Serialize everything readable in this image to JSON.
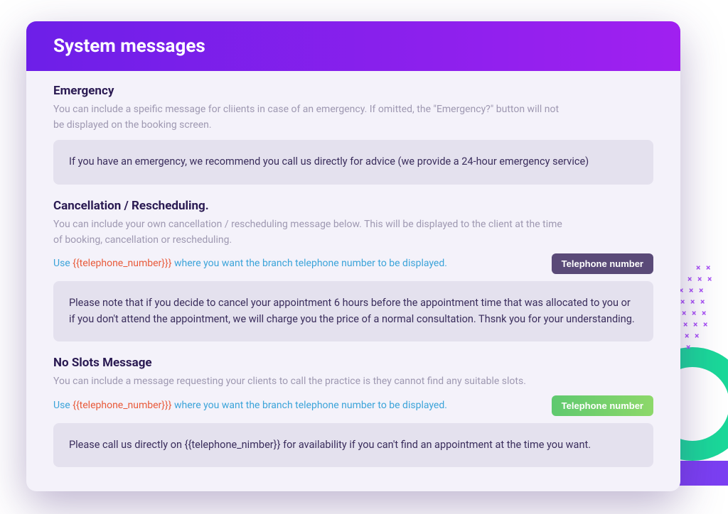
{
  "header": {
    "title": "System messages"
  },
  "sections": {
    "emergency": {
      "title": "Emergency",
      "desc": "You can include a speific message for cliients in case of an emergency. If omitted, the \"Emergency?\" button will not be displayed on the booking screen.",
      "value": "If you have an emergency, we recommend you call us directly for advice (we provide a 24-hour emergency service)"
    },
    "cancellation": {
      "title": "Cancellation / Rescheduling.",
      "desc": "You can include your own cancellation / rescheduling message below. This will be displayed to the client at the time of booking, cancellation or rescheduling.",
      "hint_use": "Use ",
      "hint_token": "{{telephone_number}}}",
      "hint_tail": " where you want the branch telephone number to be displayed.",
      "button": "Telephone number",
      "value": "Please note that if you decide to cancel your appointment 6 hours before the appointment time that was allocated to you or if you don't attend the appointment, we will charge you the price of a normal consultation. Thsnk you for your understanding."
    },
    "noslots": {
      "title": "No Slots Message",
      "desc": "You can include a message requesting your clients to call the practice is they cannot find any suitable slots.",
      "hint_use": "Use ",
      "hint_token": "{{telephone_number}}}",
      "hint_tail": " where you want the branch telephone number to be displayed.",
      "button": "Telephone number",
      "value": "Please call us directly on {{telephone_nimber}} for availability if you can't find an appointment at the time you want."
    }
  }
}
